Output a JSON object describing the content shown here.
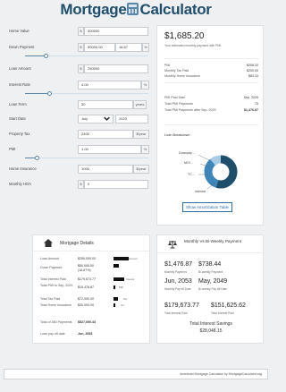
{
  "brand": {
    "left": "Mortgage",
    "right": "Calculator"
  },
  "form": {
    "home_value": {
      "label": "Home Value",
      "prefix": "$",
      "value": "300000"
    },
    "down_payment": {
      "label": "Down Payment",
      "prefix": "$",
      "value": "50000.00",
      "pct": "16.67",
      "pct_suffix": "%",
      "slider_fraction": 0.17
    },
    "loan_amount": {
      "label": "Loan Amount",
      "prefix": "$",
      "value": "250000"
    },
    "interest_rate": {
      "label": "Interest Rate",
      "value": "4.00",
      "suffix": "%",
      "slider_fraction": 0.2
    },
    "loan_term": {
      "label": "Loan Term",
      "value": "30",
      "suffix": "years"
    },
    "start_date": {
      "label": "Start Date",
      "month": "July",
      "year": "2023"
    },
    "property_tax": {
      "label": "Property Tax",
      "value": "2400",
      "suffix": "$/year"
    },
    "pmi": {
      "label": "PMI",
      "value": "1.00",
      "suffix": "%",
      "slider_fraction": 0.1
    },
    "home_insurance": {
      "label": "Home Insurance",
      "value": "1000",
      "suffix": "$/year"
    },
    "monthly_hoa": {
      "label": "Monthly HOA",
      "prefix": "$",
      "value": "0"
    }
  },
  "summary": {
    "amount": "$1,685.20",
    "subtitle": "Your estimated monthly payment with PMI.",
    "rows1": [
      {
        "label": "PMI",
        "value": "$208.33"
      },
      {
        "label": "Monthly Tax Paid",
        "value": "$200.00"
      },
      {
        "label": "Monthly Home Insurance",
        "value": "$83.33"
      }
    ],
    "rows2": [
      {
        "label": "PMI Paid Date",
        "value": "Sep, 2029"
      },
      {
        "label": "Total PMI Payments",
        "value": "75"
      },
      {
        "label": "Total PMI Payments after Sep, 2029",
        "value": "$1,476.87"
      }
    ],
    "breakdown_title": "Loan Breakdown",
    "donut_labels": [
      "Downpay...",
      "MOI...",
      "TC...",
      "Interest"
    ],
    "button": "Show Amortization Table"
  },
  "details": {
    "title": "Mortgage Details",
    "rows": [
      {
        "label": "Loan Amount",
        "value": "$250,000.00",
        "bar": 0.55,
        "bar_label": "Amount"
      },
      {
        "label": "Down Payment",
        "value": "$50,000.00 (16.67%)",
        "bar": 0.0,
        "bar_label": ""
      },
      {
        "label": "Total Interest Paid",
        "value": "$179,673.77",
        "bar": 0.4,
        "bar_label": "Interest"
      },
      {
        "label": "Total PMI to Sep, 2029",
        "value": "$15,476.87",
        "bar": 0.05,
        "bar_label": "PMI"
      },
      {
        "label": "Total Tax Paid",
        "value": "$72,000.00",
        "bar": 0.16,
        "bar_label": "Tax"
      },
      {
        "label": "Total Home Insurance",
        "value": "$30,000.00",
        "bar": 0.07,
        "bar_label": "Ins"
      }
    ],
    "total_label": "Total of 360 Payments",
    "total_value": "$527,090.43",
    "payoff_label": "Loan pay off date",
    "payoff_value": "Jun, 2053"
  },
  "compare": {
    "title": "Monthly Vs Bi-Weekly Payment",
    "monthly_payment": "$1,476.87",
    "monthly_payment_label": "Monthly Payment",
    "biweekly_payment": "$738.44",
    "biweekly_payment_label": "Bi-weekly Payment",
    "monthly_payoff": "Jun, 2053",
    "monthly_payoff_label": "Monthly Pay off Date",
    "biweekly_payoff": "May, 2049",
    "biweekly_payoff_label": "Bi-weekly Pay off Date",
    "monthly_interest": "$179,673.77",
    "monthly_interest_label": "Total Interest Paid",
    "biweekly_interest": "$151,625.62",
    "biweekly_interest_label": "Total Interest Paid",
    "savings_label": "Total Interest Savings",
    "savings_value": "$28,048.15"
  },
  "footer": "download Mortgage Calculator by MortgageCalculator.org",
  "colors": {
    "brand": "#1f4e6b",
    "accent": "#2e6da4",
    "donut_dark": "#1f4e6b",
    "donut_mid": "#3f86b8",
    "donut_light": "#a9cbe4"
  }
}
